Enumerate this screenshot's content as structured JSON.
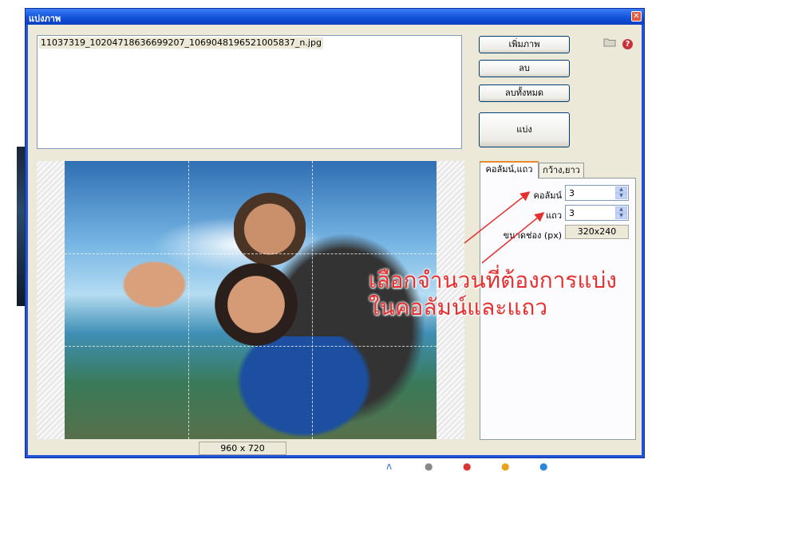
{
  "window": {
    "title": "แบ่งภาพ",
    "close_glyph": "✕"
  },
  "files": [
    "11037319_10204718636699207_1069048196521005837_n.jpg"
  ],
  "buttons": {
    "add_image": "เพิ่มภาพ",
    "delete": "ลบ",
    "delete_all": "ลบทั้งหมด",
    "split": "แบ่ง"
  },
  "icons": {
    "folder": "folder-icon",
    "help": "help-icon",
    "help_glyph": "?"
  },
  "preview": {
    "image_size": "960 x 720",
    "grid_columns": 3,
    "grid_rows": 3
  },
  "tabs": [
    {
      "label": "คอลัมน์,แถว",
      "active": true
    },
    {
      "label": "กว้าง,ยาว",
      "active": false
    }
  ],
  "settings": {
    "columns_label": "คอลัมน์",
    "columns_value": "3",
    "rows_label": "แถว",
    "rows_value": "3",
    "piece_size_label": "ขนาดช่อง (px)",
    "piece_size_value": "320x240"
  },
  "annotation": {
    "line1": "เลือกจำนวนที่ต้องการแบ่ง",
    "line2": "ในคอลัมน์และแถว",
    "color": "#e53030"
  }
}
